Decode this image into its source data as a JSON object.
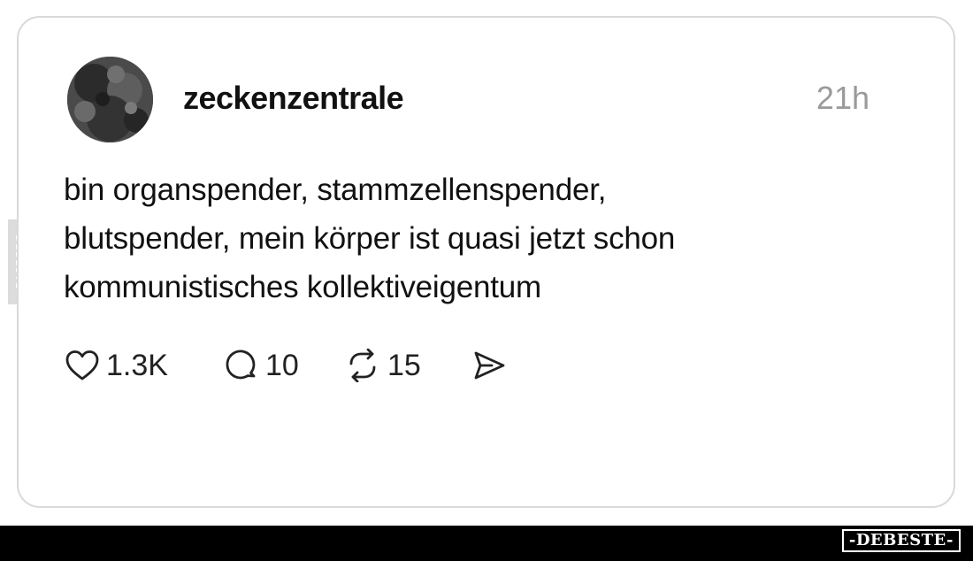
{
  "post": {
    "username": "zeckenzentrale",
    "timestamp": "21h",
    "text_lines": [
      "bin organspender, stammzellenspender,",
      "blutspender, mein körper ist quasi jetzt schon",
      "kommunistisches kollektiveigentum"
    ],
    "actions": {
      "likes": "1.3K",
      "replies": "10",
      "reposts": "15"
    },
    "icons": {
      "like": "heart-icon",
      "reply": "comment-icon",
      "repost": "repost-icon",
      "share": "send-icon"
    }
  },
  "watermark": {
    "side_text": "DEBESTE",
    "brand_text": "-DEBESTE-"
  },
  "colors": {
    "text": "#111111",
    "timestamp": "#9a9a9a",
    "card_border": "#d9d9d9",
    "bottom_bar": "#000000"
  }
}
